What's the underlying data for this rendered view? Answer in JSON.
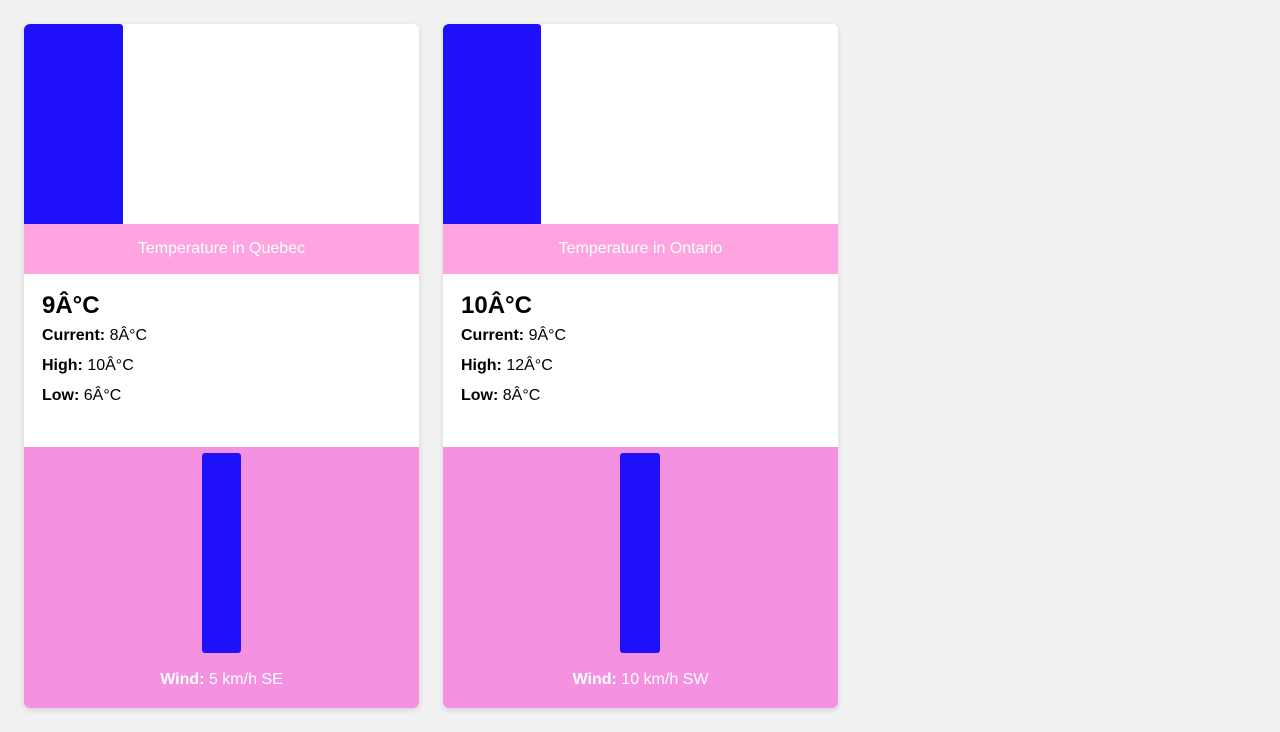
{
  "colors": {
    "page_bg": "#f1f1f1",
    "bar_blue": "#1f10fb",
    "title_pink": "#fda4e1",
    "wind_pink": "#f492e1"
  },
  "cards": [
    {
      "title": "Temperature in Quebec",
      "temperature": "9Â°C",
      "current_label": "Current:",
      "current_value": "8Â°C",
      "high_label": "High:",
      "high_value": "10Â°C",
      "low_label": "Low:",
      "low_value": "6Â°C",
      "wind_label": "Wind:",
      "wind_value": "5 km/h SE"
    },
    {
      "title": "Temperature in Ontario",
      "temperature": "10Â°C",
      "current_label": "Current:",
      "current_value": "9Â°C",
      "high_label": "High:",
      "high_value": "12Â°C",
      "low_label": "Low:",
      "low_value": "8Â°C",
      "wind_label": "Wind:",
      "wind_value": "10 km/h SW"
    }
  ]
}
